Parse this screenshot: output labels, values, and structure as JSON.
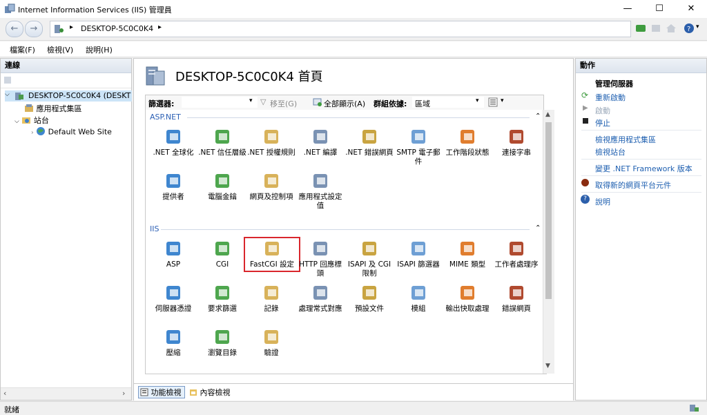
{
  "window": {
    "title": "Internet Information Services (IIS) 管理員"
  },
  "address": {
    "crumb": "DESKTOP-5C0C0K4"
  },
  "menu": [
    "檔案(F)",
    "檢視(V)",
    "說明(H)"
  ],
  "left": {
    "header": "連線",
    "tree": {
      "server": "DESKTOP-5C0C0K4 (DESKT",
      "app_pools": "應用程式集區",
      "sites": "站台",
      "default_site": "Default Web Site"
    }
  },
  "center": {
    "title": "DESKTOP-5C0C0K4 首頁",
    "filter": {
      "label": "篩選器:",
      "go": "移至(G)",
      "show_all": "全部顯示(A)",
      "group_by": "群組依據:",
      "group_value": "區域"
    },
    "groups": {
      "aspnet": {
        "label": "ASP.NET",
        "items": [
          ".NET 全球化",
          ".NET 信任層級",
          ".NET 授權規則",
          ".NET 編譯",
          ".NET 錯誤網頁",
          "SMTP 電子郵件",
          "工作階段狀態",
          "連接字串",
          "提供者",
          "電腦金鑰",
          "網頁及控制項",
          "應用程式設定值"
        ]
      },
      "iis": {
        "label": "IIS",
        "items": [
          "ASP",
          "CGI",
          "FastCGI 設定",
          "HTTP 回應標頭",
          "ISAPI 及 CGI 限制",
          "ISAPI 篩選器",
          "MIME 類型",
          "工作者處理序",
          "伺服器憑證",
          "要求篩選",
          "記錄",
          "處理常式對應",
          "預設文件",
          "模組",
          "輸出快取處理",
          "錯誤網頁",
          "壓縮",
          "瀏覽目錄",
          "驗證"
        ]
      }
    },
    "tabs": {
      "features": "功能檢視",
      "content": "內容檢視"
    }
  },
  "right": {
    "header": "動作",
    "section": "管理伺服器",
    "actions": {
      "restart": "重新啟動",
      "start": "啟動",
      "stop": "停止",
      "view_pools": "檢視應用程式集區",
      "view_sites": "檢視站台",
      "change_net": "變更 .NET Framework 版本",
      "get_platform": "取得新的網頁平台元件",
      "help": "說明"
    }
  },
  "status": {
    "text": "就緒"
  },
  "colors": {
    "link": "#1e5fb0",
    "group": "#2b5fb4",
    "highlight": "#d9262c"
  }
}
